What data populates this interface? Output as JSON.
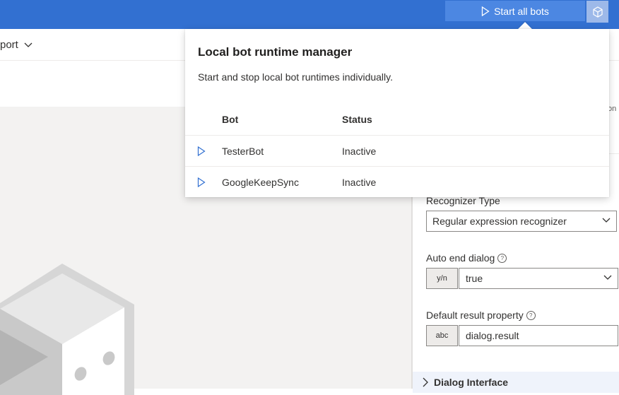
{
  "topbar": {
    "start_all_label": "Start all bots",
    "play_icon": "play-icon",
    "runtime_icon": "bot-runtime-icon",
    "colors": {
      "bar": "#3270d1",
      "button": "#4c87e2"
    }
  },
  "subbar": {
    "export_label": "port"
  },
  "properties": {
    "partial_label": "on",
    "recognizer_type": {
      "label": "Recognizer Type",
      "value": "Regular expression recognizer"
    },
    "auto_end_dialog": {
      "label": "Auto end dialog",
      "type": "y/n",
      "value": "true"
    },
    "default_result": {
      "label": "Default result property",
      "type": "abc",
      "value": "dialog.result"
    },
    "dialog_interface_label": "Dialog Interface"
  },
  "popup": {
    "title": "Local bot runtime manager",
    "description": "Start and stop local bot runtimes individually.",
    "columns": {
      "bot": "Bot",
      "status": "Status"
    },
    "rows": [
      {
        "bot": "TesterBot",
        "status": "Inactive"
      },
      {
        "bot": "GoogleKeepSync",
        "status": "Inactive"
      }
    ]
  }
}
